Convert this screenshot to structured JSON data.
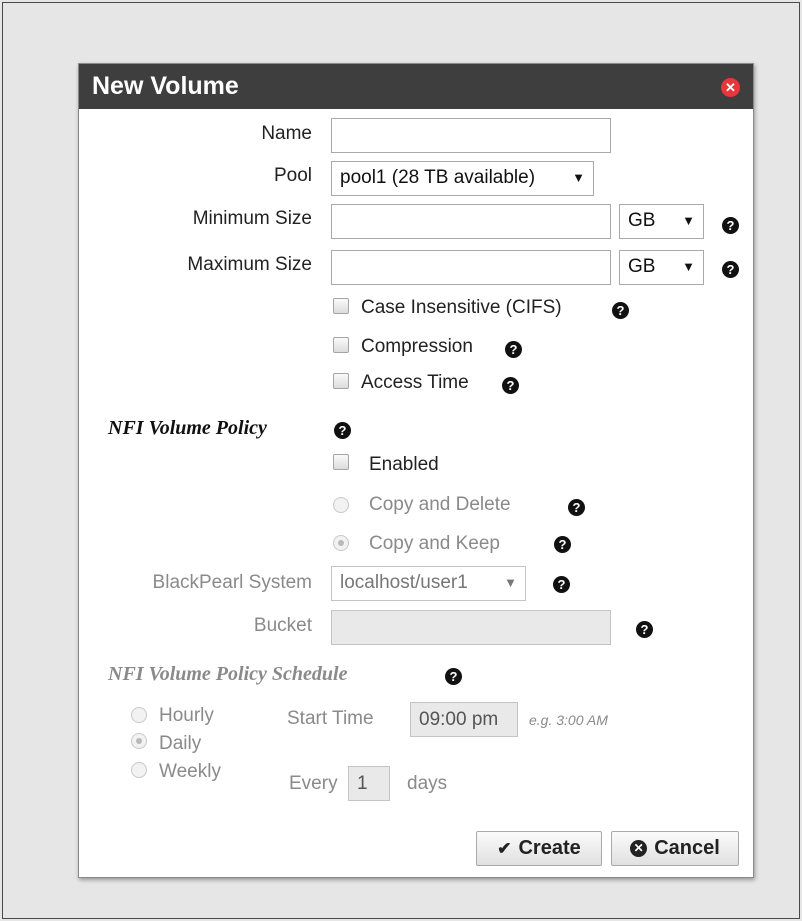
{
  "dialog": {
    "title": "New Volume"
  },
  "form": {
    "name_label": "Name",
    "name_value": "",
    "pool_label": "Pool",
    "pool_value": "pool1 (28 TB available)",
    "min_size_label": "Minimum Size",
    "min_size_value": "",
    "min_unit": "GB",
    "max_size_label": "Maximum Size",
    "max_size_value": "",
    "max_unit": "GB",
    "case_insensitive_label": "Case Insensitive (CIFS)",
    "compression_label": "Compression",
    "access_time_label": "Access Time"
  },
  "nfi_policy": {
    "heading": "NFI Volume Policy",
    "enabled_label": "Enabled",
    "copy_delete_label": "Copy and Delete",
    "copy_keep_label": "Copy and Keep",
    "blackpearl_label": "BlackPearl System",
    "blackpearl_value": "localhost/user1",
    "bucket_label": "Bucket",
    "bucket_value": ""
  },
  "schedule": {
    "heading": "NFI Volume Policy Schedule",
    "hourly_label": "Hourly",
    "daily_label": "Daily",
    "weekly_label": "Weekly",
    "start_time_label": "Start Time",
    "start_time_value": "09:00 pm",
    "start_time_hint": "e.g. 3:00 AM",
    "every_label": "Every",
    "every_value": "1",
    "days_label": "days"
  },
  "buttons": {
    "create_label": "Create",
    "cancel_label": "Cancel"
  }
}
